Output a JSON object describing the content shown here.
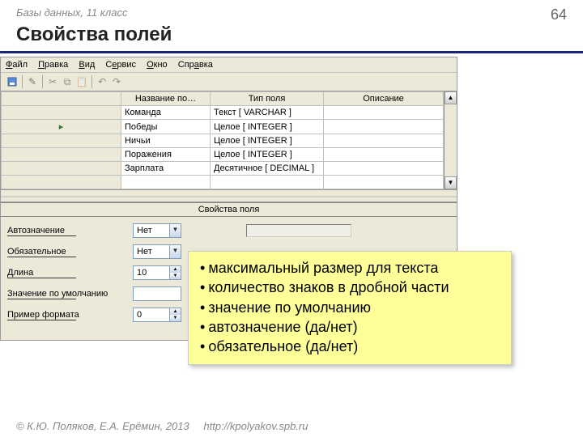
{
  "slide": {
    "breadcrumb": "Базы данных, 11 класс",
    "page": "64",
    "title": "Свойства полей"
  },
  "menu": {
    "file": "Файл",
    "edit": "Правка",
    "view": "Вид",
    "service": "Сервис",
    "window": "Окно",
    "help": "Справка"
  },
  "grid": {
    "col_name": "Название по…",
    "col_type": "Тип поля",
    "col_desc": "Описание",
    "rows": [
      {
        "name": "Команда",
        "type": "Текст [ VARCHAR ]"
      },
      {
        "name": "Победы",
        "type": "Целое [ INTEGER ]"
      },
      {
        "name": "Ничьи",
        "type": "Целое [ INTEGER ]"
      },
      {
        "name": "Поражения",
        "type": "Целое [ INTEGER ]"
      },
      {
        "name": "Зарплата",
        "type": "Десятичное [ DECIMAL ]"
      }
    ]
  },
  "props": {
    "header": "Свойства поля",
    "autovalue": {
      "label": "Автозначение",
      "value": "Нет"
    },
    "required": {
      "label": "Обязательное",
      "value": "Нет"
    },
    "length": {
      "label": "Длина",
      "value": "10"
    },
    "default": {
      "label": "Значение по умолчанию",
      "value": ""
    },
    "format": {
      "label": "Пример формата",
      "value": "0"
    }
  },
  "callout": {
    "i1": "максимальный размер для текста",
    "i2": "количество знаков в дробной части",
    "i3": "значение по умолчанию",
    "i4": "автозначение (да/нет)",
    "i5": "обязательное (да/нет)"
  },
  "footer": {
    "copyright": "© К.Ю. Поляков, Е.А. Ерёмин, 2013",
    "url": "http://kpolyakov.spb.ru"
  }
}
